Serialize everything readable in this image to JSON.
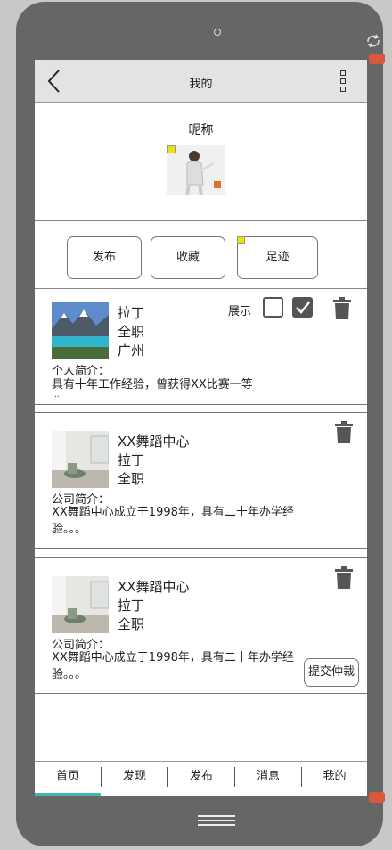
{
  "header": {
    "title": "我的"
  },
  "profile": {
    "nickname": "昵称"
  },
  "actions": [
    {
      "label": "发布"
    },
    {
      "label": "收藏"
    },
    {
      "label": "足迹"
    }
  ],
  "cards": [
    {
      "lines": [
        "拉丁",
        "全职",
        "广州"
      ],
      "intro_label": "个人简介：",
      "intro_text": "具有十年工作经验，曾获得XX比赛一等",
      "intro_more": "...",
      "show_label": "展示",
      "checkbox_empty_checked": false,
      "checkbox_filled_checked": true
    },
    {
      "lines": [
        "XX舞蹈中心",
        "拉丁",
        "全职"
      ],
      "intro_label": "公司简介：",
      "intro_text": "XX舞蹈中心成立于1998年，具有二十年办学经验。。。"
    },
    {
      "lines": [
        "XX舞蹈中心",
        "拉丁",
        "全职"
      ],
      "intro_label": "公司简介：",
      "intro_text": "XX舞蹈中心成立于1998年，具有二十年办学经验。。。",
      "arbitration_label": "提交仲裁"
    }
  ],
  "tabbar": {
    "tabs": [
      {
        "label": "首页"
      },
      {
        "label": "发现"
      },
      {
        "label": "发布"
      },
      {
        "label": "消息"
      },
      {
        "label": "我的"
      }
    ],
    "active_index": 0,
    "active_color": "#3fb8b0"
  },
  "icons": {
    "back": "chevron-left-icon",
    "more": "more-vertical-icon",
    "delete": "trash-icon",
    "rotate": "rotate-icon",
    "home": "home-bars-icon"
  }
}
